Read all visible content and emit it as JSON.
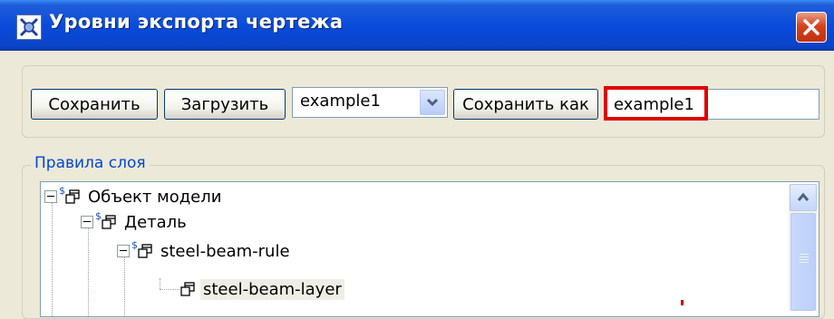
{
  "window": {
    "title": "Уровни экспорта чертежа",
    "title_color": "#0a4bdc"
  },
  "toolbar": {
    "save_label": "Сохранить",
    "load_label": "Загрузить",
    "preset_select": {
      "selected": "example1"
    },
    "save_as_label": "Сохранить как",
    "name_value": "example1"
  },
  "rules_group": {
    "legend": "Правила слоя"
  },
  "tree": {
    "nodes": [
      {
        "label": "Объект модели",
        "level": 0,
        "expanded": true,
        "marker": "$"
      },
      {
        "label": "Деталь",
        "level": 1,
        "expanded": true,
        "marker": "$"
      },
      {
        "label": "steel-beam-rule",
        "level": 2,
        "expanded": true,
        "marker": "$"
      },
      {
        "label": "steel-beam-layer",
        "level": 3,
        "selected": true
      }
    ]
  },
  "colors": {
    "highlight": "#e00000",
    "legend_text": "#0046d5"
  },
  "icons": [
    "app-icon",
    "close-icon",
    "dropdown-arrow-icon",
    "expand-toggle-icon",
    "object-node-icon",
    "scroll-up-icon"
  ]
}
